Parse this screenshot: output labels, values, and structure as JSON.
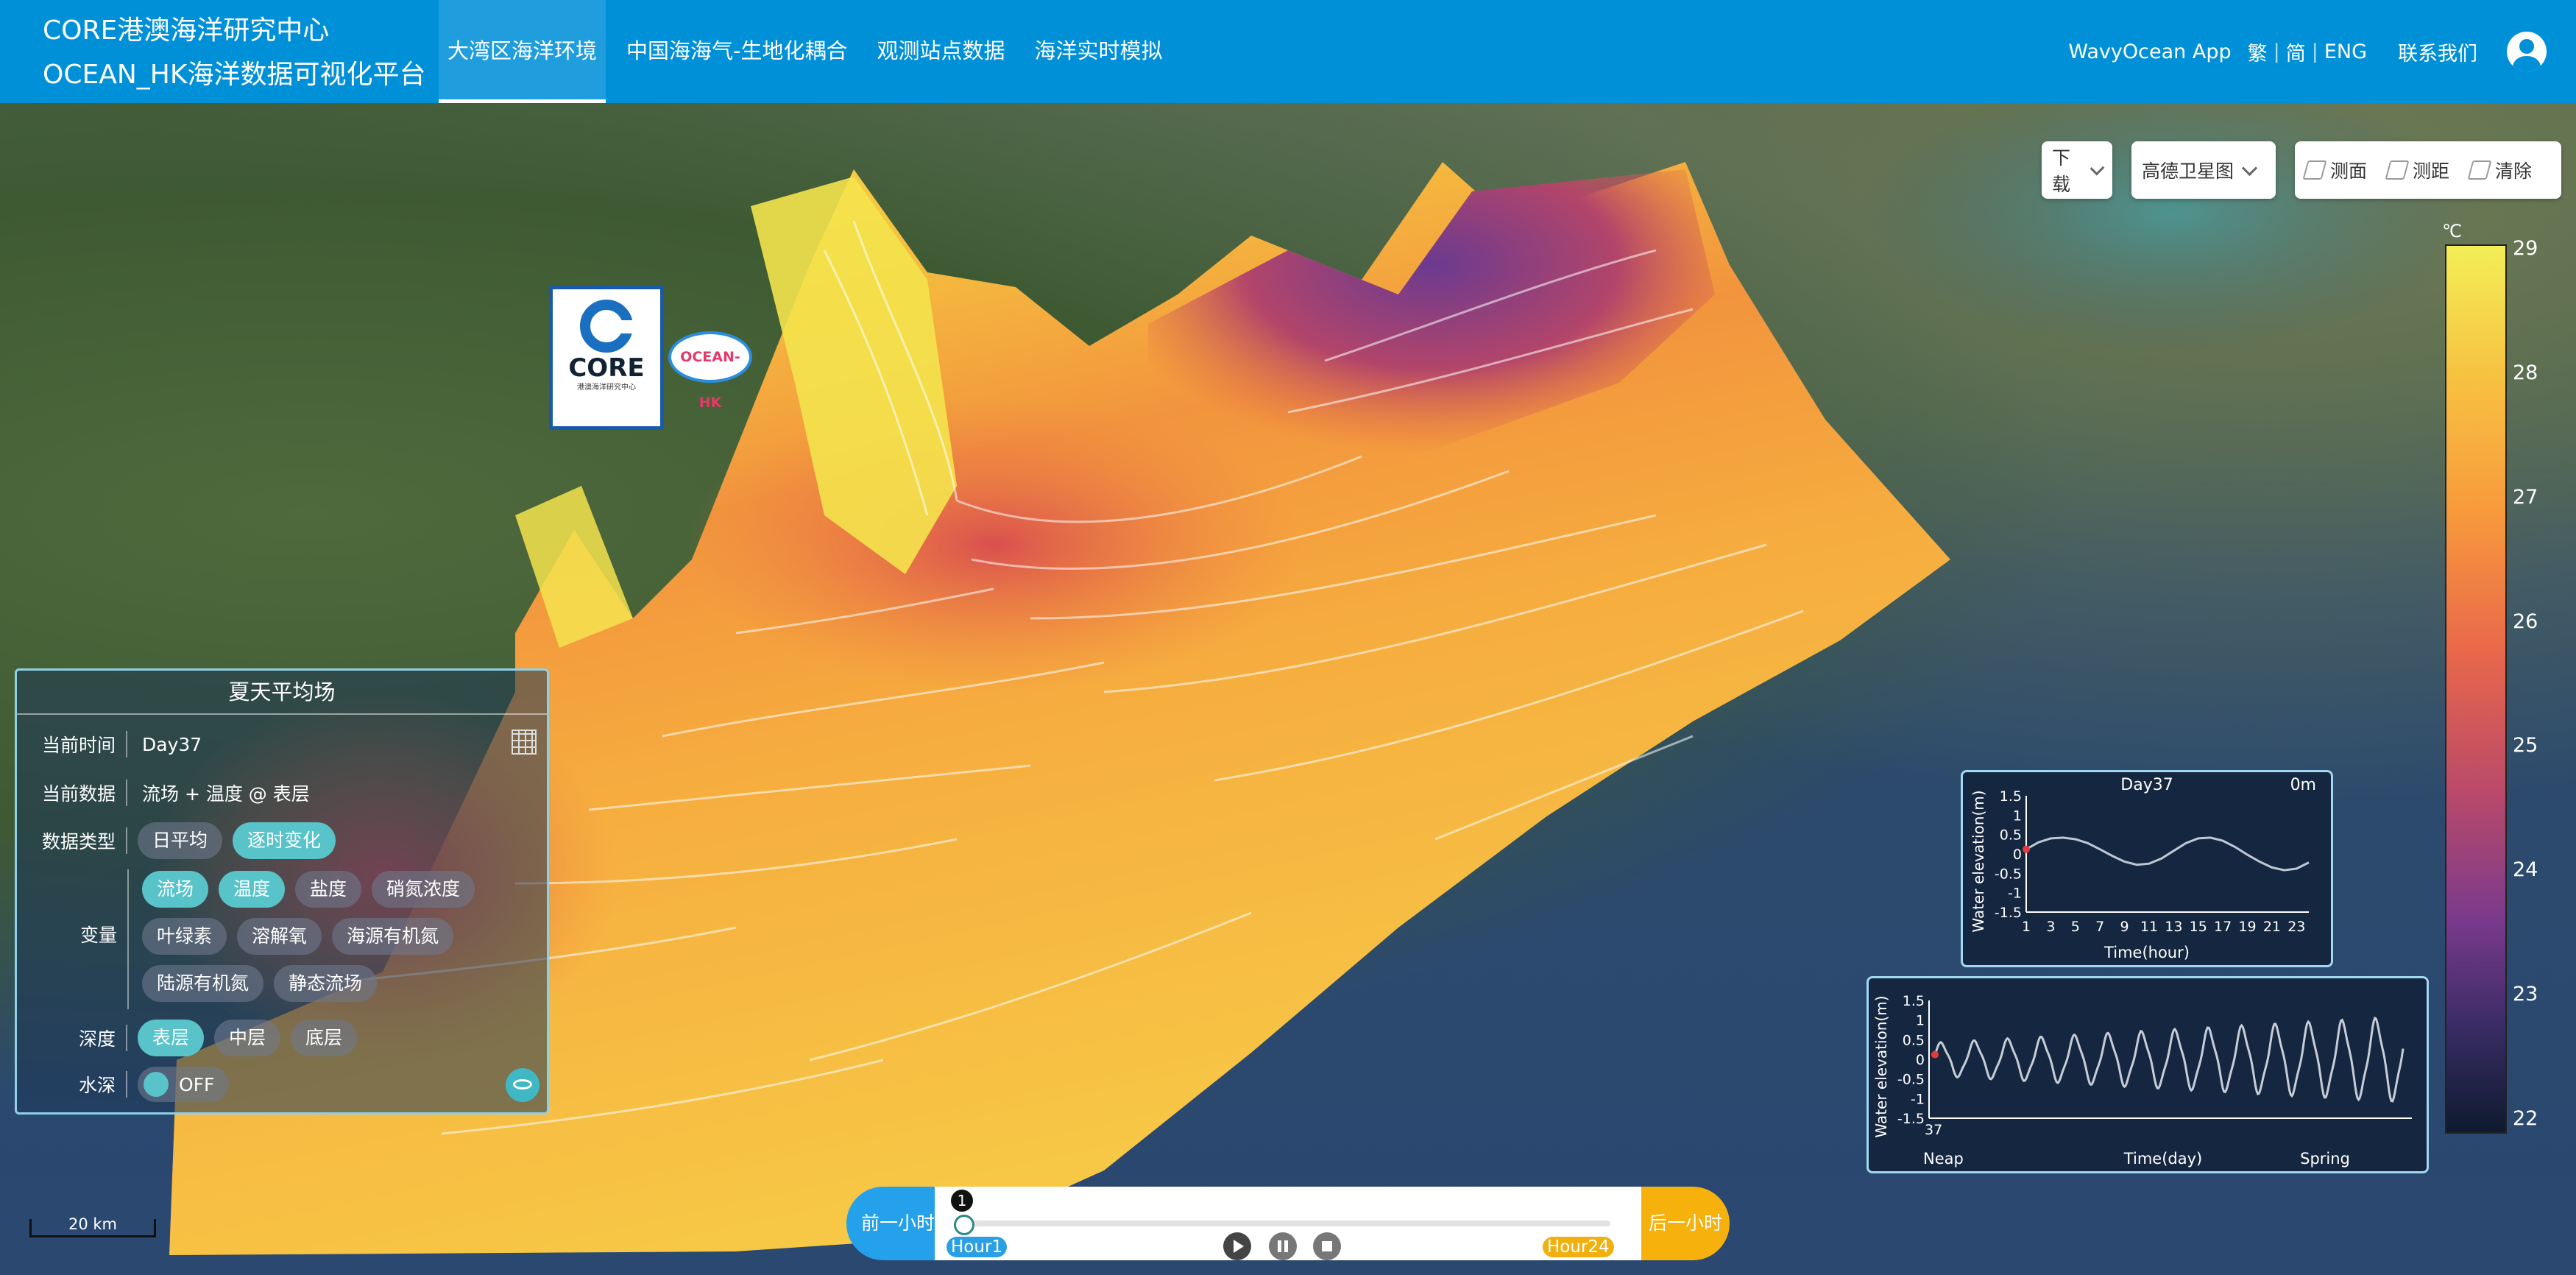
{
  "header": {
    "brand_line1": "CORE港澳海洋研究中心",
    "brand_line2": "OCEAN_HK海洋数据可视化平台",
    "tabs": [
      {
        "label": "大湾区海洋环境",
        "active": true
      },
      {
        "label": "中国海海气-生地化耦合",
        "active": false
      },
      {
        "label": "观测站点数据",
        "active": false
      },
      {
        "label": "海洋实时模拟",
        "active": false
      }
    ],
    "app_link": "WavyOcean App",
    "lang_traditional": "繁",
    "lang_simplified": "简",
    "lang_english": "ENG",
    "contact": "联系我们"
  },
  "toolbar": {
    "download": "下载",
    "basemap": "高德卫星图",
    "measure_area": "测面",
    "measure_distance": "测距",
    "clear": "清除"
  },
  "colorbar": {
    "unit": "℃",
    "ticks": [
      "29",
      "28",
      "27",
      "26",
      "25",
      "24",
      "23",
      "22"
    ],
    "colors": [
      "#f3ee57",
      "#f79a3c",
      "#e8674a",
      "#b8496a",
      "#7a3a8c",
      "#3a2c66",
      "#0d1a2e"
    ]
  },
  "logos": {
    "core_text": "CORE",
    "core_sub": "港澳海洋研究中心",
    "ocean_hk": "OCEAN-HK"
  },
  "panel": {
    "title": "夏天平均场",
    "time_label": "当前时间",
    "time_value": "Day37",
    "data_label": "当前数据",
    "data_value": "流场 + 温度 @ 表层",
    "type_label": "数据类型",
    "types": [
      {
        "label": "日平均",
        "on": false
      },
      {
        "label": "逐时变化",
        "on": true
      }
    ],
    "var_label": "变量",
    "variables_row1": [
      {
        "label": "流场",
        "on": true
      },
      {
        "label": "温度",
        "on": true
      },
      {
        "label": "盐度",
        "on": false
      },
      {
        "label": "硝氮浓度",
        "on": false
      }
    ],
    "variables_row2": [
      {
        "label": "叶绿素",
        "on": false
      },
      {
        "label": "溶解氧",
        "on": false
      },
      {
        "label": "海源有机氮",
        "on": false
      }
    ],
    "variables_row3": [
      {
        "label": "陆源有机氮",
        "on": false
      },
      {
        "label": "静态流场",
        "on": false
      }
    ],
    "depth_label": "深度",
    "depths": [
      {
        "label": "表层",
        "on": true
      },
      {
        "label": "中层",
        "on": false
      },
      {
        "label": "底层",
        "on": false
      }
    ],
    "bathy_label": "水深",
    "bathy_toggle": "OFF"
  },
  "chart_data": [
    {
      "type": "line",
      "title": "Day37",
      "corner_label": "0m",
      "xlabel": "Time(hour)",
      "ylabel": "Water elevation(m)",
      "x_ticks": [
        "1",
        "3",
        "5",
        "7",
        "9",
        "11",
        "13",
        "15",
        "17",
        "19",
        "21",
        "23"
      ],
      "y_ticks": [
        "1.5",
        "1",
        "0.5",
        "0",
        "-0.5",
        "-1",
        "-1.5"
      ],
      "ylim": [
        -1.5,
        1.5
      ],
      "xlim": [
        1,
        24
      ],
      "x": [
        1,
        2,
        3,
        4,
        5,
        6,
        7,
        8,
        9,
        10,
        11,
        12,
        13,
        14,
        15,
        16,
        17,
        18,
        19,
        20,
        21,
        22,
        23,
        24
      ],
      "values": [
        0.12,
        0.3,
        0.4,
        0.42,
        0.38,
        0.28,
        0.12,
        -0.05,
        -0.2,
        -0.28,
        -0.25,
        -0.12,
        0.08,
        0.28,
        0.4,
        0.42,
        0.34,
        0.18,
        -0.02,
        -0.2,
        -0.35,
        -0.42,
        -0.38,
        -0.22
      ],
      "marker": {
        "x": 1,
        "y": 0.12,
        "color": "#e53a3a"
      }
    },
    {
      "type": "line",
      "xlabel": "Time(day)",
      "ylabel": "Water elevation(m)",
      "x_ticks": [
        "37"
      ],
      "phase_labels": [
        "Neap",
        "Spring"
      ],
      "y_ticks": [
        "1.5",
        "1",
        "0.5",
        "0",
        "-0.5",
        "-1",
        "-1.5"
      ],
      "ylim": [
        -1.5,
        1.5
      ],
      "cycles": 14,
      "amplitude_start": 0.45,
      "amplitude_end": 1.15,
      "marker": {
        "x": 0,
        "y": 0.12,
        "color": "#e53a3a"
      }
    }
  ],
  "timeline": {
    "prev": "前一小时",
    "next": "后一小时",
    "start_label": "Hour1",
    "end_label": "Hour24",
    "current": "1",
    "current_hour": 1,
    "total_hours": 24
  },
  "scalebar": {
    "label": "20 km"
  }
}
